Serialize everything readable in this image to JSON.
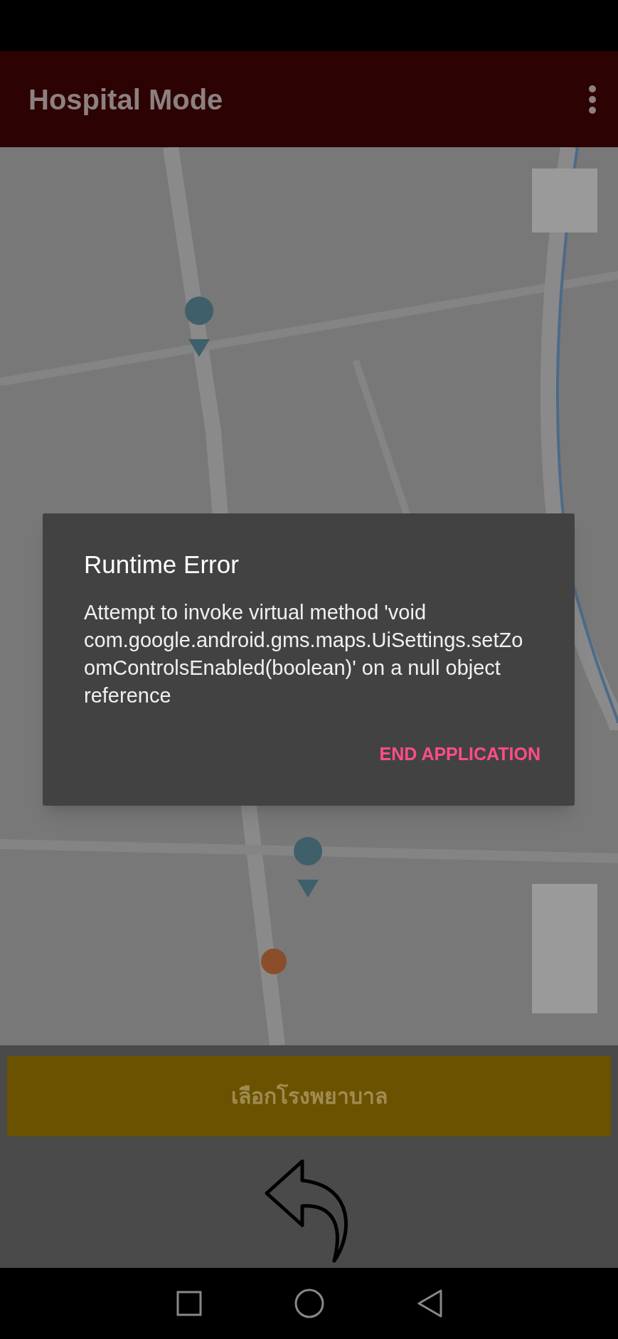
{
  "app_bar": {
    "title": "Hospital Mode"
  },
  "dialog": {
    "title": "Runtime Error",
    "message": "Attempt to invoke virtual method 'void com.google.android.gms.maps.UiSettings.setZoomControlsEnabled(boolean)' on a null object reference",
    "button": "END APPLICATION"
  },
  "select_button": {
    "label": "เลือกโรงพยาบาล"
  }
}
